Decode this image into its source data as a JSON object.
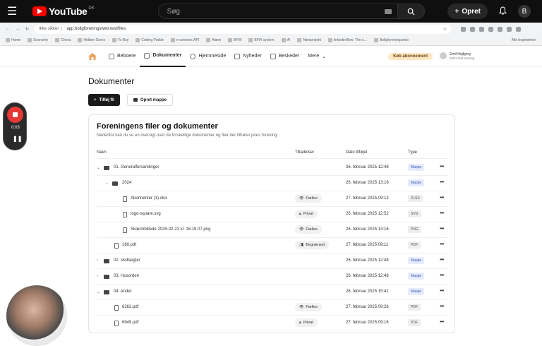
{
  "youtube": {
    "logo_word": "YouTube",
    "country": "DK",
    "search_placeholder": "Søg",
    "create_label": "Opret",
    "avatar_letter": "B"
  },
  "browser": {
    "security_label": "Ikke sikker",
    "url": "app.boligforeningsweb.test/files",
    "bookmarks": [
      "Home",
      "Economy",
      "Chess",
      "Hidden Gems",
      "To Buy",
      "Coding Prakte",
      "e-conomic API",
      "Alarm",
      "BFW",
      "BFW system",
      "AI",
      "Næsprojekt",
      "linkedin/flow: The o...",
      "Boligforeningsweb"
    ],
    "all_bookmarks": "Alle bogmærker"
  },
  "app_nav": {
    "items": [
      {
        "label": "Beboere",
        "icon": "users-icon"
      },
      {
        "label": "Dokumenter",
        "icon": "files-icon",
        "active": true
      },
      {
        "label": "Hjemmeside",
        "icon": "globe-icon"
      },
      {
        "label": "Nyheder",
        "icon": "news-icon"
      },
      {
        "label": "Beskeder",
        "icon": "megaphone-icon"
      },
      {
        "label": "Mere",
        "icon": "chevron-down-icon"
      }
    ],
    "buy_label": "Køb abonnement",
    "user_name": "Emil Hejbjerg",
    "user_org": "Emil's test forening"
  },
  "page": {
    "title": "Dokumenter",
    "add_file": "Tilføj fil",
    "create_folder": "Opret mappe"
  },
  "card": {
    "title": "Foreningens filer og dokumenter",
    "subtitle": "Nedenfor kan du se en oversigt over de forskellige dokumenter og filer der tilhører jeres forening.",
    "columns": {
      "name": "Navn",
      "perm": "Tilladelser",
      "date": "Dato tilføjet",
      "type": "Type"
    },
    "rows": [
      {
        "name": "01. Generalforsamlinger",
        "kind": "folder",
        "expanded": true,
        "level": 0,
        "perm": "",
        "date": "26. februar 2025 12:48",
        "type": "Mappe"
      },
      {
        "name": "2024",
        "kind": "folder",
        "expanded": true,
        "level": 1,
        "perm": "",
        "date": "26. februar 2025 13:16",
        "type": "Mappe"
      },
      {
        "name": "Abonnenter (1).xlsx",
        "kind": "file",
        "level": 2,
        "perm": "Fælles",
        "perm_icon": "eye-icon",
        "date": "27. februar 2025 09:13",
        "type": "XLSX"
      },
      {
        "name": "logo-square.svg",
        "kind": "file",
        "level": 2,
        "perm": "Privat",
        "perm_icon": "lock-icon",
        "date": "26. februar 2025 12:52",
        "type": "SVG"
      },
      {
        "name": "Skærmbillede 2025-02-22 kl. 16.19.07.png",
        "kind": "file",
        "level": 2,
        "perm": "Fælles",
        "perm_icon": "eye-icon",
        "date": "26. februar 2025 13:16",
        "type": "PNG"
      },
      {
        "name": "160.pdf",
        "kind": "file",
        "level": 1,
        "perm": "Begrænset",
        "perm_icon": "users-icon",
        "date": "27. februar 2025 09:11",
        "type": "PDF"
      },
      {
        "name": "02. Vedtægter",
        "kind": "folder",
        "expanded": false,
        "level": 0,
        "perm": "",
        "date": "26. februar 2025 12:48",
        "type": "Mappe"
      },
      {
        "name": "03. Husorden",
        "kind": "folder",
        "expanded": false,
        "level": 0,
        "perm": "",
        "date": "26. februar 2025 12:48",
        "type": "Mappe"
      },
      {
        "name": "04. Andet",
        "kind": "folder",
        "expanded": true,
        "level": 0,
        "perm": "",
        "date": "26. februar 2025 15:41",
        "type": "Mappe"
      },
      {
        "name": "6262.pdf",
        "kind": "file",
        "level": 1,
        "perm": "Fælles",
        "perm_icon": "eye-icon",
        "date": "27. februar 2025 09:26",
        "type": "PDF"
      },
      {
        "name": "6949.pdf",
        "kind": "file",
        "level": 1,
        "perm": "Privat",
        "perm_icon": "lock-icon",
        "date": "27. februar 2025 09:16",
        "type": "PDF"
      }
    ]
  },
  "recorder": {
    "time": "0:03"
  }
}
